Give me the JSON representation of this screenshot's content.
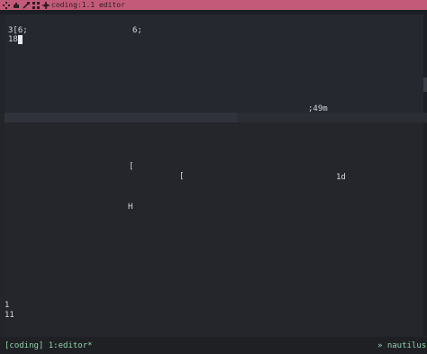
{
  "window": {
    "title": "coding:1.1 editor",
    "icons": [
      "diamond-grid-icon",
      "cloud-icon",
      "tools-icon",
      "grid-icon",
      "layout-icon"
    ]
  },
  "editor_top": {
    "line1_left": "3[6;",
    "line1_right": "6;",
    "line2": "18",
    "status_fragment": ";49m"
  },
  "editor_bottom": {
    "bracket_a": "[",
    "bracket_b": "[",
    "code_1d": "1d",
    "letter_h": "H",
    "line_num_1": "1",
    "line_num_11": "11"
  },
  "statusbar": {
    "session": "[coding] 1:editor*",
    "host_glyph": "»",
    "host": "nautilus"
  },
  "colors": {
    "titlebar": "#c45a7a",
    "background": "#23252b",
    "status_text": "#8fd4a8"
  }
}
